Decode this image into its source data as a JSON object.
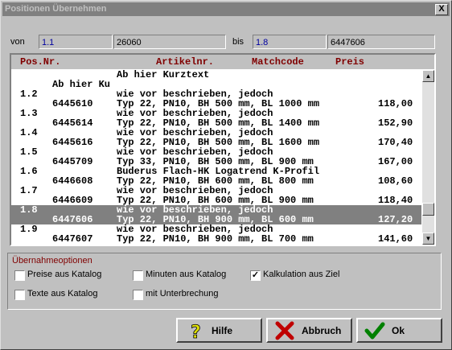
{
  "window": {
    "title": "Positionen Übernehmen",
    "close_label": "X"
  },
  "range": {
    "von_label": "von",
    "von_pos": "1.1",
    "von_article": "26060",
    "bis_label": "bis",
    "bis_pos": "1.8",
    "bis_article": "6447606"
  },
  "list": {
    "headers": {
      "pos": "Pos.Nr.",
      "article": "Artikelnr.",
      "match": "Matchcode",
      "price": "Preis"
    },
    "rows": [
      {
        "c1": "",
        "c2": "Ab hier Kurztext",
        "c3": "",
        "sel": false
      },
      {
        "c1": "Ab hier Ku",
        "c2": "",
        "c3": "",
        "sel": false
      },
      {
        "c1": "1.2",
        "c2": "wie vor beschrieben, jedoch",
        "c3": "",
        "sel": false
      },
      {
        "c1": "6445610",
        "c2": "Typ 22, PN10, BH 500 mm, BL 1000 mm",
        "c3": "118,00",
        "sel": false
      },
      {
        "c1": "1.3",
        "c2": "wie vor beschrieben, jedoch",
        "c3": "",
        "sel": false
      },
      {
        "c1": "6445614",
        "c2": "Typ 22, PN10, BH 500 mm, BL 1400 mm",
        "c3": "152,90",
        "sel": false
      },
      {
        "c1": "1.4",
        "c2": "wie vor beschrieben, jedoch",
        "c3": "",
        "sel": false
      },
      {
        "c1": "6445616",
        "c2": "Typ 22, PN10, BH 500 mm, BL 1600 mm",
        "c3": "170,40",
        "sel": false
      },
      {
        "c1": "1.5",
        "c2": "wie vor beschrieben, jedoch",
        "c3": "",
        "sel": false
      },
      {
        "c1": "6445709",
        "c2": "Typ 33, PN10, BH 500 mm, BL 900 mm",
        "c3": "167,00",
        "sel": false
      },
      {
        "c1": "1.6",
        "c2": "Buderus Flach-HK Logatrend K-Profil",
        "c3": "",
        "sel": false
      },
      {
        "c1": "6446608",
        "c2": "Typ 22, PN10, BH 600 mm, BL 800 mm",
        "c3": "108,60",
        "sel": false
      },
      {
        "c1": "1.7",
        "c2": "wie vor beschrieben, jedoch",
        "c3": "",
        "sel": false
      },
      {
        "c1": "6446609",
        "c2": "Typ 22, PN10, BH 600 mm, BL 900 mm",
        "c3": "118,40",
        "sel": false
      },
      {
        "c1": "1.8",
        "c2": "wie vor beschrieben, jedoch",
        "c3": "",
        "sel": true
      },
      {
        "c1": "6447606",
        "c2": "Typ 22, PN10, BH 900 mm, BL 600 mm",
        "c3": "127,20",
        "sel": true
      },
      {
        "c1": "1.9",
        "c2": "wie vor beschrieben, jedoch",
        "c3": "",
        "sel": false
      },
      {
        "c1": "6447607",
        "c2": "Typ 22, PN10, BH 900 mm, BL 700 mm",
        "c3": "141,60",
        "sel": false
      }
    ]
  },
  "options": {
    "title": "Übernahmeoptionen",
    "preise": {
      "label": "Preise aus Katalog",
      "checked": false
    },
    "minuten": {
      "label": "Minuten aus Katalog",
      "checked": false
    },
    "kalkulation": {
      "label": "Kalkulation aus Ziel",
      "checked": true
    },
    "texte": {
      "label": "Texte aus Katalog",
      "checked": false
    },
    "unterbrechung": {
      "label": "mit Unterbrechung",
      "checked": false
    }
  },
  "buttons": {
    "help": "Hilfe",
    "cancel": "Abbruch",
    "ok": "Ok"
  },
  "colors": {
    "header_text": "#800000",
    "selection": "#808080",
    "ok_icon": "#008000",
    "cancel_icon": "#c00000",
    "help_icon": "#e0e000"
  }
}
